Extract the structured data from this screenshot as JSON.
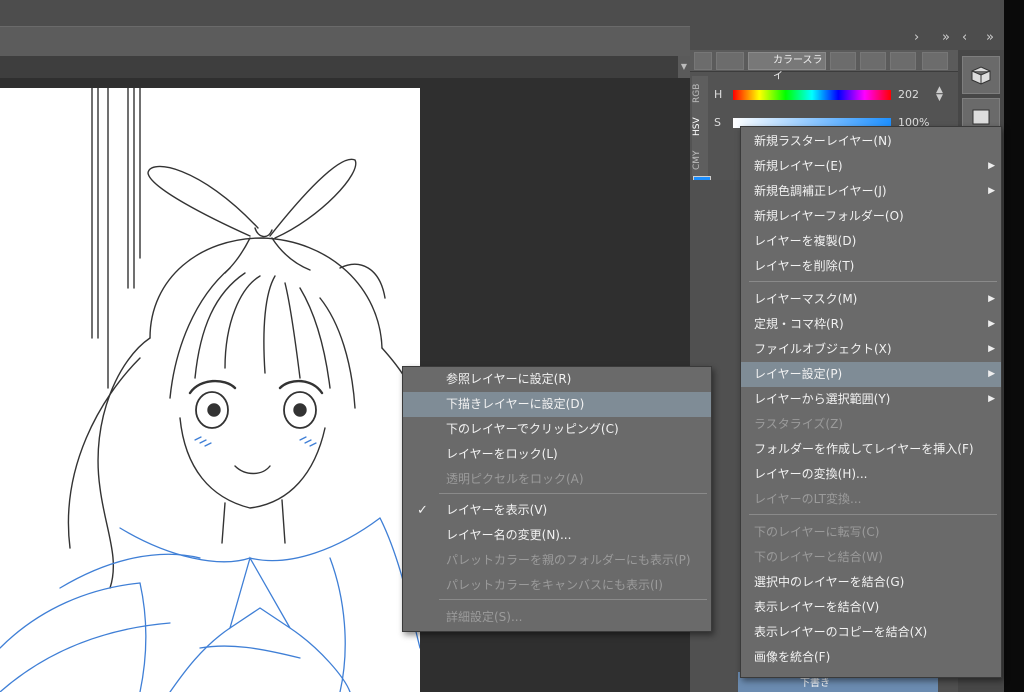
{
  "panel": {
    "color_tab_label": "カラースライ",
    "side_tabs": [
      "RGB",
      "HSV",
      "CMY"
    ],
    "hue": {
      "label": "H",
      "value": "202"
    },
    "saturation": {
      "label": "S",
      "value": "100%"
    }
  },
  "layer_panel": {
    "row_label": "下書き"
  },
  "context_menu": {
    "items": [
      {
        "label": "新規ラスターレイヤー(N)",
        "submenu": false,
        "disabled": false
      },
      {
        "label": "新規レイヤー(E)",
        "submenu": true,
        "disabled": false
      },
      {
        "label": "新規色調補正レイヤー(J)",
        "submenu": true,
        "disabled": false
      },
      {
        "label": "新規レイヤーフォルダー(O)",
        "submenu": false,
        "disabled": false
      },
      {
        "label": "レイヤーを複製(D)",
        "submenu": false,
        "disabled": false
      },
      {
        "label": "レイヤーを削除(T)",
        "submenu": false,
        "disabled": false
      },
      {
        "label": "レイヤーマスク(M)",
        "submenu": true,
        "disabled": false
      },
      {
        "label": "定規・コマ枠(R)",
        "submenu": true,
        "disabled": false
      },
      {
        "label": "ファイルオブジェクト(X)",
        "submenu": true,
        "disabled": false
      },
      {
        "label": "レイヤー設定(P)",
        "submenu": true,
        "disabled": false,
        "highlighted": true
      },
      {
        "label": "レイヤーから選択範囲(Y)",
        "submenu": true,
        "disabled": false
      },
      {
        "label": "ラスタライズ(Z)",
        "submenu": false,
        "disabled": true
      },
      {
        "label": "フォルダーを作成してレイヤーを挿入(F)",
        "submenu": false,
        "disabled": false
      },
      {
        "label": "レイヤーの変換(H)...",
        "submenu": false,
        "disabled": false
      },
      {
        "label": "レイヤーのLT変換...",
        "submenu": false,
        "disabled": true
      },
      {
        "label": "下のレイヤーに転写(C)",
        "submenu": false,
        "disabled": true
      },
      {
        "label": "下のレイヤーと結合(W)",
        "submenu": false,
        "disabled": true
      },
      {
        "label": "選択中のレイヤーを結合(G)",
        "submenu": false,
        "disabled": false
      },
      {
        "label": "表示レイヤーを結合(V)",
        "submenu": false,
        "disabled": false
      },
      {
        "label": "表示レイヤーのコピーを結合(X)",
        "submenu": false,
        "disabled": false
      },
      {
        "label": "画像を統合(F)",
        "submenu": false,
        "disabled": false
      }
    ]
  },
  "layer_settings_submenu": {
    "items": [
      {
        "label": "参照レイヤーに設定(R)",
        "disabled": false,
        "checked": false
      },
      {
        "label": "下描きレイヤーに設定(D)",
        "disabled": false,
        "checked": false,
        "highlighted": true
      },
      {
        "label": "下のレイヤーでクリッピング(C)",
        "disabled": false,
        "checked": false
      },
      {
        "label": "レイヤーをロック(L)",
        "disabled": false,
        "checked": false
      },
      {
        "label": "透明ピクセルをロック(A)",
        "disabled": true,
        "checked": false
      },
      {
        "label": "レイヤーを表示(V)",
        "disabled": false,
        "checked": true
      },
      {
        "label": "レイヤー名の変更(N)...",
        "disabled": false,
        "checked": false
      },
      {
        "label": "パレットカラーを親のフォルダーにも表示(P)",
        "disabled": true,
        "checked": false
      },
      {
        "label": "パレットカラーをキャンバスにも表示(I)",
        "disabled": true,
        "checked": false
      },
      {
        "label": "詳細設定(S)...",
        "disabled": true,
        "checked": false
      }
    ]
  },
  "colors": {
    "menu_bg": "#6a6a6a",
    "highlight": "#7f8c96",
    "draft_line_blue": "#3f7fd6",
    "current_color": "#1c8fff"
  }
}
